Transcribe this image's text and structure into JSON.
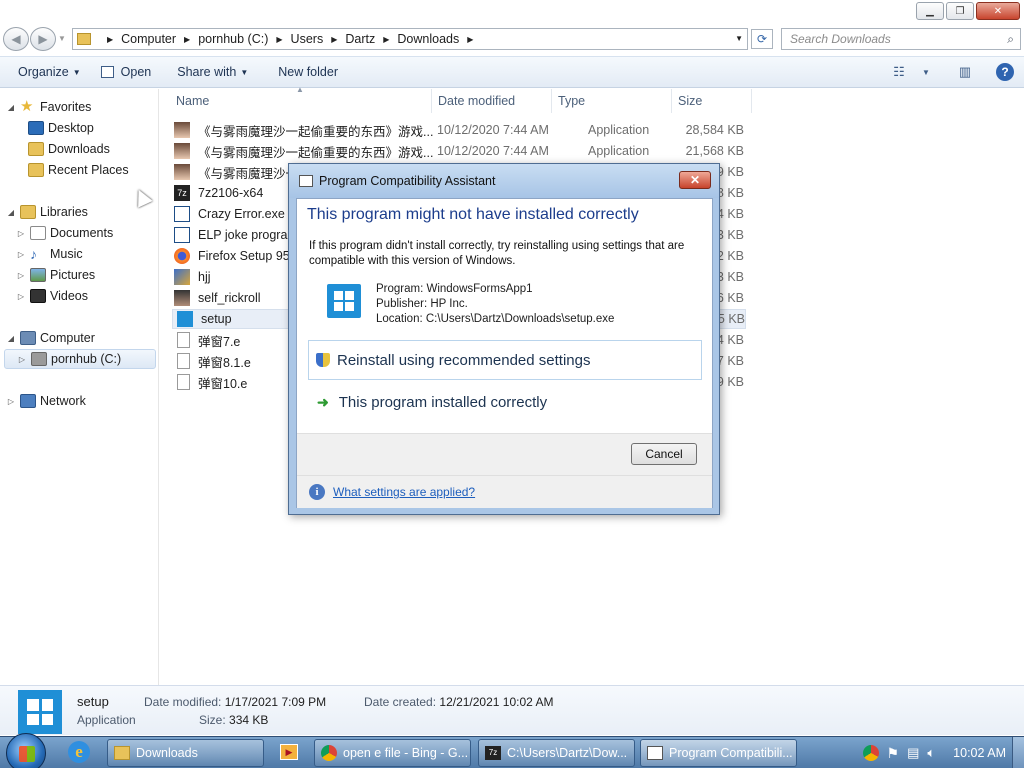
{
  "address": {
    "crumbs": [
      "Computer",
      "pornhub (C:)",
      "Users",
      "Dartz",
      "Downloads"
    ],
    "search_placeholder": "Search Downloads"
  },
  "toolbar": {
    "organize": "Organize",
    "open": "Open",
    "share_with": "Share with",
    "new_folder": "New folder"
  },
  "nav": {
    "favorites": "Favorites",
    "desktop": "Desktop",
    "downloads": "Downloads",
    "recent_places": "Recent Places",
    "libraries": "Libraries",
    "documents": "Documents",
    "music": "Music",
    "pictures": "Pictures",
    "videos": "Videos",
    "computer": "Computer",
    "drive": "pornhub (C:)",
    "network": "Network"
  },
  "columns": {
    "name": "Name",
    "date": "Date modified",
    "type": "Type",
    "size": "Size"
  },
  "files": [
    {
      "name": "《与雾雨魔理沙一起偷重要的东西》游戏...",
      "date": "10/12/2020 7:44 AM",
      "type": "Application",
      "size": "28,584 KB"
    },
    {
      "name": "《与雾雨魔理沙一起偷重要的东西》游戏...",
      "date": "10/12/2020 7:44 AM",
      "type": "Application",
      "size": "21,568 KB"
    },
    {
      "name": "《与雾雨魔理沙一",
      "date": "",
      "type": "",
      "size": "9 KB"
    },
    {
      "name": "7z2106-x64",
      "date": "",
      "type": "",
      "size": "8 KB"
    },
    {
      "name": "Crazy Error.exe by",
      "date": "",
      "type": "",
      "size": "4 KB"
    },
    {
      "name": "ELP joke program",
      "date": "",
      "type": "",
      "size": "3 KB"
    },
    {
      "name": "Firefox Setup 95.0",
      "date": "",
      "type": "",
      "size": "2 KB"
    },
    {
      "name": "hjj",
      "date": "",
      "type": "",
      "size": "3 KB"
    },
    {
      "name": "self_rickroll",
      "date": "",
      "type": "",
      "size": "6 KB"
    },
    {
      "name": "setup",
      "date": "",
      "type": "",
      "size": "5 KB"
    },
    {
      "name": "弹窗7.e",
      "date": "",
      "type": "",
      "size": "4 KB"
    },
    {
      "name": "弹窗8.1.e",
      "date": "",
      "type": "",
      "size": "7 KB"
    },
    {
      "name": "弹窗10.e",
      "date": "",
      "type": "",
      "size": "9 KB"
    }
  ],
  "dialog": {
    "title": "Program Compatibility Assistant",
    "heading": "This program might not have installed correctly",
    "description": "If this program didn't install correctly, try reinstalling using settings that are compatible with this version of Windows.",
    "program": "Program: WindowsFormsApp1",
    "publisher": "Publisher: HP Inc.",
    "location": "Location: C:\\Users\\Dartz\\Downloads\\setup.exe",
    "option_reinstall": "Reinstall using recommended settings",
    "option_ok": "This program installed correctly",
    "cancel": "Cancel",
    "link": "What settings are applied?"
  },
  "details": {
    "name": "setup",
    "kind": "Application",
    "date_modified_label": "Date modified:",
    "date_modified": "1/17/2021 7:09 PM",
    "size_label": "Size:",
    "size": "334 KB",
    "date_created_label": "Date created:",
    "date_created": "12/21/2021 10:02 AM"
  },
  "taskbar": {
    "downloads": "Downloads",
    "bing": "open e file - Bing - G...",
    "sevenzip": "C:\\Users\\Dartz\\Dow...",
    "pca": "Program Compatibili...",
    "clock": "10:02 AM"
  },
  "colors": {
    "accent": "#1c3d8c",
    "link": "#1d5ebd",
    "app_icon": "#1f8fd6",
    "taskbar": "#4f79a7"
  }
}
